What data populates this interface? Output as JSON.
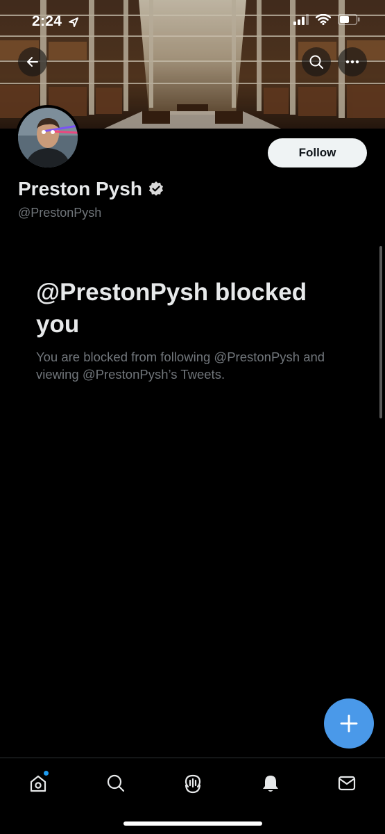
{
  "status_bar": {
    "time": "2:24"
  },
  "profile": {
    "display_name": "Preston Pysh",
    "handle": "@PrestonPysh",
    "verified": true,
    "follow_label": "Follow"
  },
  "blocked": {
    "title": "@PrestonPysh blocked you",
    "message": "You are blocked from following @PrestonPysh and viewing @PrestonPysh’s Tweets."
  },
  "icons": {
    "back": "arrow-left-icon",
    "search": "search-icon",
    "more": "more-icon",
    "compose": "plus-icon",
    "tabs": [
      "home-icon",
      "search-icon",
      "spaces-icon",
      "notifications-icon",
      "messages-icon"
    ]
  },
  "colors": {
    "background": "#000000",
    "accent": "#1d9bf0",
    "fab": "#4a99e9",
    "text_primary": "#e7e9ea",
    "text_secondary": "#71767b",
    "follow_bg": "#eff3f4"
  },
  "tab_bar": {
    "home_has_new": true
  }
}
